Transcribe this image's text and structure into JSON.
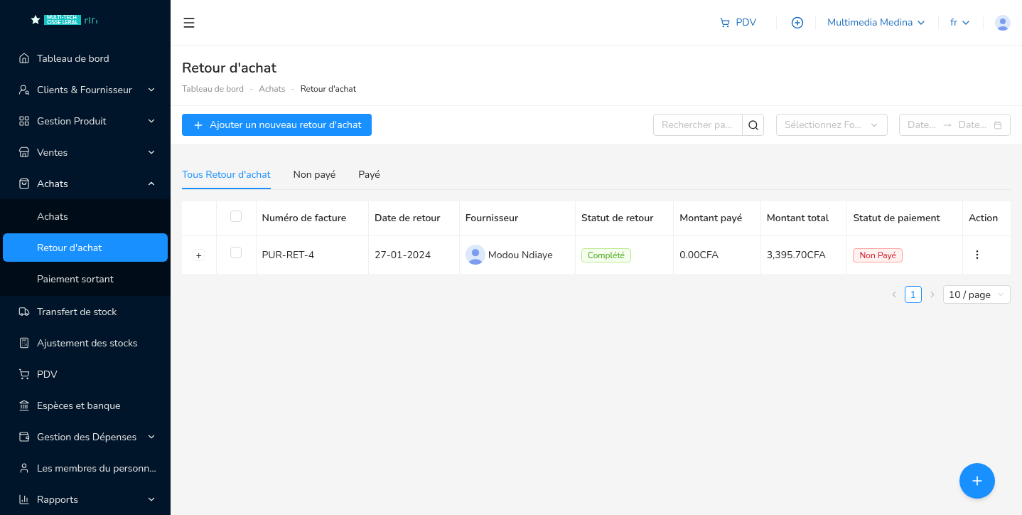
{
  "logo": {
    "line1": "MULTI-TECH",
    "line2": "CISSE LERAL"
  },
  "sidebar": {
    "items": [
      {
        "label": "Tableau de bord",
        "kind": "link"
      },
      {
        "label": "Clients & Fournisseur",
        "kind": "group",
        "expanded": false
      },
      {
        "label": "Gestion Produit",
        "kind": "group",
        "expanded": false
      },
      {
        "label": "Ventes",
        "kind": "group",
        "expanded": false
      },
      {
        "label": "Achats",
        "kind": "group",
        "expanded": true,
        "children": [
          {
            "label": "Achats",
            "selected": false
          },
          {
            "label": "Retour d'achat",
            "selected": true
          },
          {
            "label": "Paiement sortant",
            "selected": false
          }
        ]
      },
      {
        "label": "Transfert de stock",
        "kind": "link"
      },
      {
        "label": "Ajustement des stocks",
        "kind": "link"
      },
      {
        "label": "PDV",
        "kind": "link"
      },
      {
        "label": "Espèces et banque",
        "kind": "link"
      },
      {
        "label": "Gestion des Dépenses",
        "kind": "group",
        "expanded": false
      },
      {
        "label": "Les membres du personn...",
        "kind": "link"
      },
      {
        "label": "Rapports",
        "kind": "group",
        "expanded": false
      }
    ]
  },
  "header": {
    "pos": "PDV",
    "store": "Multimedia Medina",
    "language": "fr"
  },
  "page": {
    "title": "Retour d'achat",
    "breadcrumb": [
      "Tableau de bord",
      "Achats",
      "Retour d'achat"
    ],
    "breadcrumb_separator": "-",
    "add_button": "Ajouter un nouveau retour d'achat",
    "search": {
      "placeholder": "Rechercher pa..."
    },
    "supplier_select": {
      "placeholder": "Sélectionnez Fo..."
    },
    "date_range": {
      "start_placeholder": "Date...",
      "end_placeholder": "Date..."
    }
  },
  "tabs": [
    {
      "label": "Tous Retour d'achat",
      "selected": true
    },
    {
      "label": "Non payé",
      "selected": false
    },
    {
      "label": "Payé",
      "selected": false
    }
  ],
  "table": {
    "header_checked": false,
    "columns": [
      "Numéro de facture",
      "Date de retour",
      "Fournisseur",
      "Statut de retour",
      "Montant payé",
      "Montant total",
      "Statut de paiement",
      "Action"
    ],
    "rows": [
      {
        "expand": "+",
        "checked": false,
        "invoice": "PUR-RET-4",
        "date": "27-01-2024",
        "supplier": "Modou Ndiaye",
        "return_status": {
          "text": "Complété",
          "kind": "success"
        },
        "paid": "0.00CFA",
        "total": "3,395.70CFA",
        "payment_status": {
          "text": "Non Payé",
          "kind": "danger"
        }
      }
    ]
  },
  "pagination": {
    "pages": [
      {
        "label": "1",
        "selected": true
      }
    ],
    "page_size": "10 / page"
  }
}
